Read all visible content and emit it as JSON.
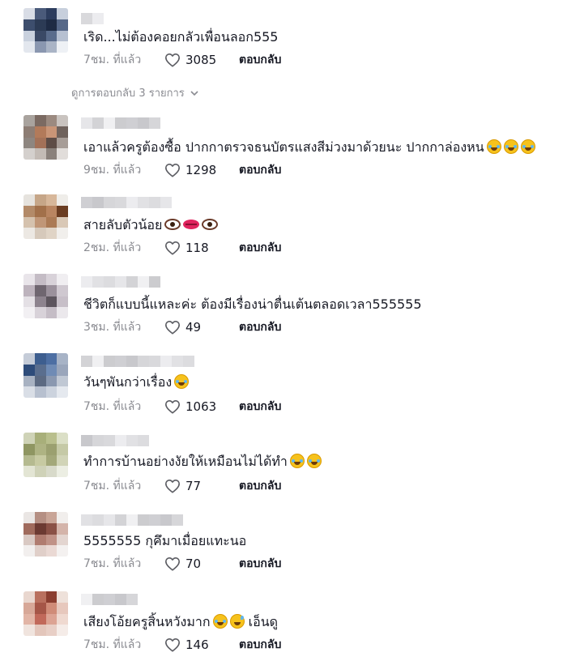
{
  "like_label_icon": "heart-outline-icon",
  "view_replies": {
    "label": "ดูการตอบกลับ 3 รายการ",
    "icon": "chevron-down-icon"
  },
  "comments": [
    {
      "text": "เริด...ไม่ต้องคอยกลัวเพื่อนลอก555",
      "time": "7ชม. ที่แล้ว",
      "likes": "3085",
      "reply": "ตอบกลับ",
      "emojis": []
    },
    {
      "text": "เอาแล้วครูต้องซื้อ ปากกาตรวจธนบัตรแสงสีม่วงมาด้วยนะ ปากกาล่องหน",
      "time": "9ชม. ที่แล้ว",
      "likes": "1298",
      "reply": "ตอบกลับ",
      "emojis": [
        "laugh-emoji",
        "laugh-emoji",
        "laugh-emoji"
      ]
    },
    {
      "text": "สายลับตัวน้อย",
      "time": "2ชม. ที่แล้ว",
      "likes": "118",
      "reply": "ตอบกลับ",
      "emojis": [
        "eye-emoji",
        "lips-emoji",
        "eye-emoji"
      ]
    },
    {
      "text": "ชีวิตก็แบบนี้แหละค่ะ ต้องมีเรื่องน่าตื่นเต้นตลอดเวลา555555",
      "time": "3ชม. ที่แล้ว",
      "likes": "49",
      "reply": "ตอบกลับ",
      "emojis": []
    },
    {
      "text": "วันๆพันกว่าเรื่อง",
      "time": "7ชม. ที่แล้ว",
      "likes": "1063",
      "reply": "ตอบกลับ",
      "emojis": [
        "laugh-emoji"
      ]
    },
    {
      "text": "ทำการบ้านอย่างงัยให้เหมือนไม่ได้ทำ",
      "time": "7ชม. ที่แล้ว",
      "likes": "77",
      "reply": "ตอบกลับ",
      "emojis": [
        "laugh-emoji",
        "laugh-emoji"
      ]
    },
    {
      "text": "5555555 กุคึมาเมื่อยแทะนอ",
      "time": "7ชม. ที่แล้ว",
      "likes": "70",
      "reply": "ตอบกลับ",
      "emojis": []
    },
    {
      "text": "เสียงโอ้ยครูสิ้นหวังมาก",
      "text_after": "เอ็นดู",
      "time": "7ชม. ที่แล้ว",
      "likes": "146",
      "reply": "ตอบกลับ",
      "emojis": [
        "laugh-emoji",
        "sweat-smile-emoji"
      ]
    }
  ]
}
